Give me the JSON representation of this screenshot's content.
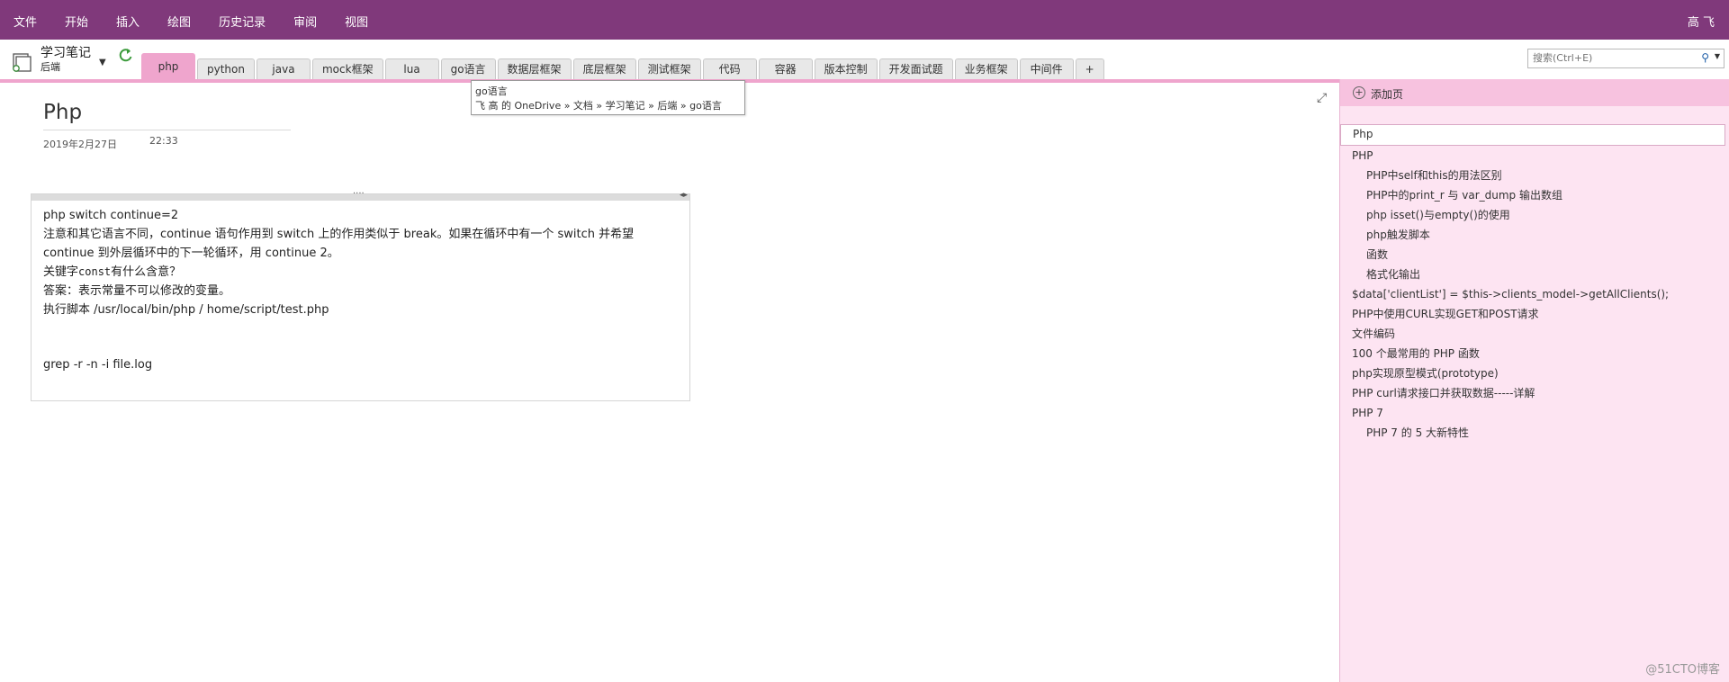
{
  "menu": {
    "items": [
      "文件",
      "开始",
      "插入",
      "绘图",
      "历史记录",
      "审阅",
      "视图"
    ],
    "user": "高 飞"
  },
  "notebook": {
    "title": "学习笔记",
    "section_group": "后端",
    "icon": "notebook-icon",
    "sync_icon": "sync-icon"
  },
  "tabs": [
    "php",
    "python",
    "java",
    "mock框架",
    "lua",
    "go语言",
    "数据层框架",
    "底层框架",
    "测试框架",
    "代码",
    "容器",
    "版本控制",
    "开发面试题",
    "业务框架",
    "中间件"
  ],
  "tab_add_label": "+",
  "search": {
    "placeholder": "搜索(Ctrl+E)"
  },
  "tooltip": {
    "title": "go语言",
    "path": "飞 高 的 OneDrive » 文档 » 学习笔记 » 后端 » go语言"
  },
  "page": {
    "title": "Php",
    "date": "2019年2月27日",
    "time": "22:33"
  },
  "note": {
    "line1": "php switch continue=2",
    "line2": "注意和其它语言不同，continue 语句作用到 switch 上的作用类似于 break。如果在循环中有一个 switch 并希望",
    "line3": "continue 到外层循环中的下一轮循环，用 continue 2。",
    "line4a": "关键字",
    "line4b": "const",
    "line4c": "有什么含意？",
    "line5": " 答案：表示常量不可以修改的变量。",
    "line6": "执行脚本    /usr/local/bin/php /       home/script/test.php",
    "line7": "grep -r -n -i file.log"
  },
  "right_panel": {
    "add_page_label": "添加页",
    "search_value": "Php",
    "pages": [
      {
        "label": "PHP",
        "sub": false
      },
      {
        "label": "PHP中self和this的用法区别",
        "sub": true
      },
      {
        "label": "PHP中的print_r 与 var_dump 输出数组",
        "sub": true
      },
      {
        "label": "php isset()与empty()的使用",
        "sub": true
      },
      {
        "label": "php触发脚本",
        "sub": true
      },
      {
        "label": "函数",
        "sub": true
      },
      {
        "label": "格式化输出",
        "sub": true
      },
      {
        "label": "$data['clientList'] = $this->clients_model->getAllClients();",
        "sub": false
      },
      {
        "label": "PHP中使用CURL实现GET和POST请求",
        "sub": false
      },
      {
        "label": "文件编码",
        "sub": false
      },
      {
        "label": "100 个最常用的 PHP 函数",
        "sub": false
      },
      {
        "label": "php实现原型模式(prototype)",
        "sub": false
      },
      {
        "label": "PHP curl请求接口并获取数据-----详解",
        "sub": false
      },
      {
        "label": "PHP 7",
        "sub": false
      },
      {
        "label": "PHP 7 的 5 大新特性",
        "sub": true
      }
    ]
  },
  "watermark": "@51CTO博客",
  "colors": {
    "ribbon": "#80397b",
    "active_tab": "#efa5cd",
    "panel": "#fde4f2"
  }
}
